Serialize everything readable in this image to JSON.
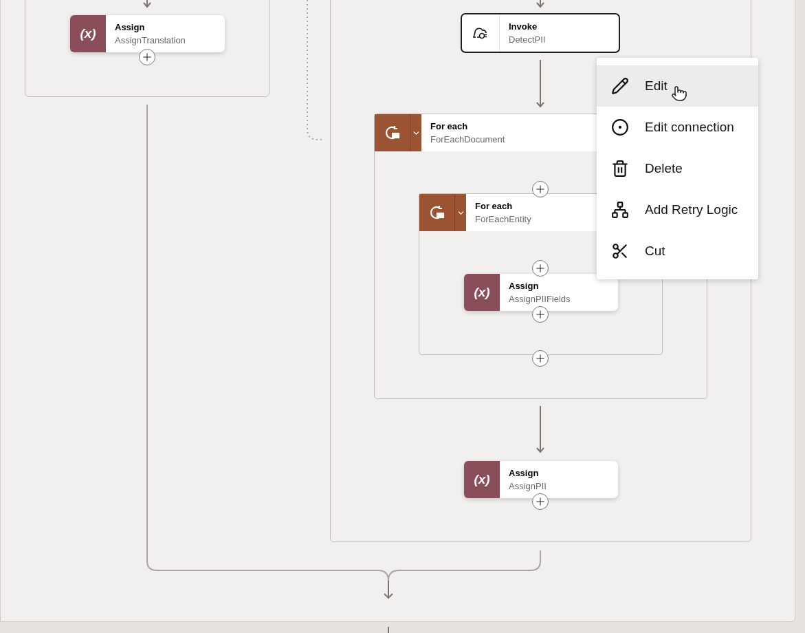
{
  "left_branch": {
    "nodes": [
      {
        "kind": "assign",
        "icon_text": "(x)",
        "title": "Assign",
        "name": "AssignTranslation",
        "selected": false
      }
    ]
  },
  "right_branch": {
    "nodes": [
      {
        "kind": "invoke",
        "title": "Invoke",
        "name": "DetectPII",
        "selected": true
      },
      {
        "kind": "foreach",
        "title": "For each",
        "name": "ForEachDocument",
        "selected": false,
        "children": [
          {
            "kind": "foreach",
            "title": "For each",
            "name": "ForEachEntity",
            "selected": false,
            "children": [
              {
                "kind": "assign",
                "icon_text": "(x)",
                "title": "Assign",
                "name": "AssignPIIFields",
                "selected": false
              }
            ]
          }
        ]
      },
      {
        "kind": "assign",
        "icon_text": "(x)",
        "title": "Assign",
        "name": "AssignPII",
        "selected": false
      }
    ]
  },
  "context_menu": {
    "items": [
      {
        "kind": "edit",
        "label": "Edit",
        "highlighted": true
      },
      {
        "kind": "connection",
        "label": "Edit connection",
        "highlighted": false
      },
      {
        "kind": "delete",
        "label": "Delete",
        "highlighted": false
      },
      {
        "kind": "retry",
        "label": "Add Retry Logic",
        "highlighted": false
      },
      {
        "kind": "cut",
        "label": "Cut",
        "highlighted": false
      }
    ]
  }
}
